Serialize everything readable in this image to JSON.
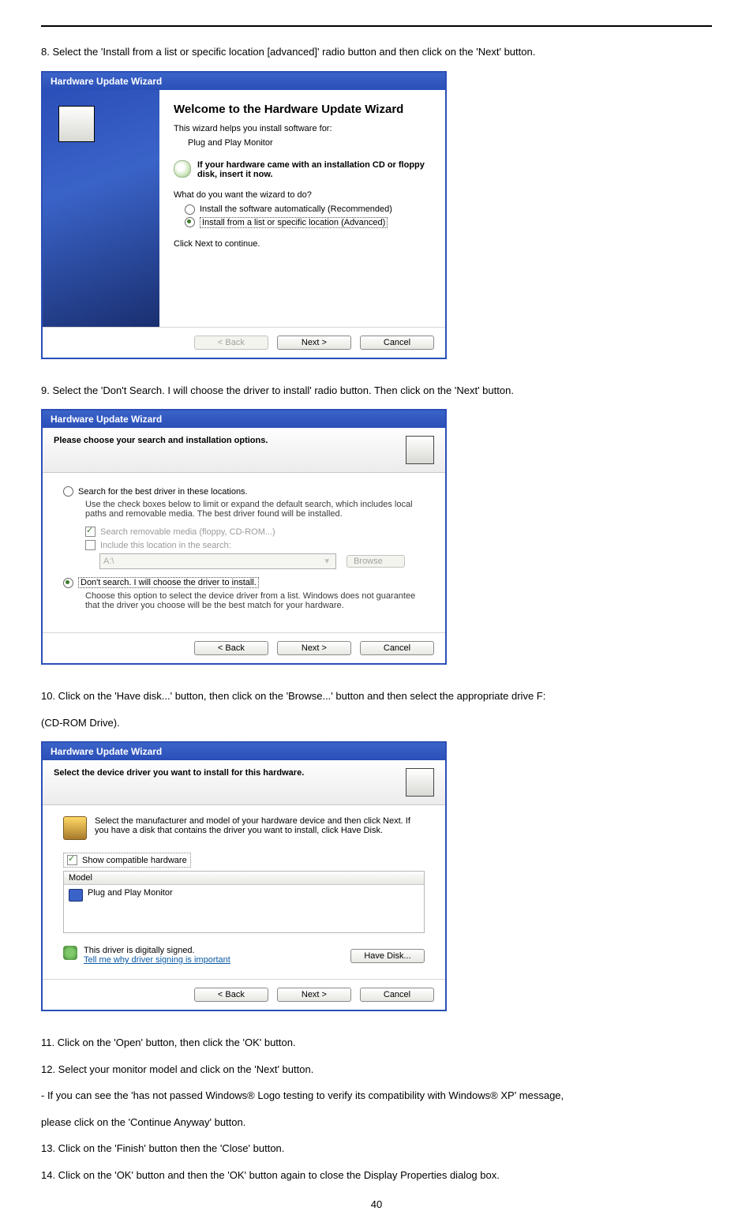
{
  "steps": {
    "s8": "8. Select the 'Install from a list or specific location [advanced]' radio button and then click on the 'Next' button.",
    "s9": "9. Select the 'Don't Search. I will choose the driver to install' radio button. Then click on the 'Next' button.",
    "s10a": "10. Click on the 'Have disk...' button, then click on the 'Browse...' button and then select the appropriate drive F:",
    "s10b": "(CD-ROM Drive).",
    "s11": "11. Click on the 'Open' button, then click the 'OK' button.",
    "s12": "12. Select your monitor model and click on the 'Next' button.",
    "s_note": "- If you can see the 'has not passed Windows® Logo testing to verify its compatibility with Windows® XP' message,",
    "s_note2": "please click on the 'Continue Anyway' button.",
    "s13": "13. Click on the 'Finish' button then the 'Close' button.",
    "s14": "14. Click on the 'OK' button and then the 'OK' button again to close the Display Properties dialog box."
  },
  "dlg_title": "Hardware Update Wizard",
  "buttons": {
    "back": "< Back",
    "next": "Next >",
    "cancel": "Cancel",
    "browse": "Browse",
    "have_disk": "Have Disk..."
  },
  "dlg1": {
    "h": "Welcome to the Hardware Update Wizard",
    "line1": "This wizard helps you install software for:",
    "device": "Plug and Play Monitor",
    "note": "If your hardware came with an installation CD or floppy disk, insert it now.",
    "q": "What do you want the wizard to do?",
    "opt1": "Install the software automatically (Recommended)",
    "opt2": "Install from a list or specific location (Advanced)",
    "cont": "Click Next to continue."
  },
  "dlg2": {
    "hdr": "Please choose your search and installation options.",
    "opt1": "Search for the best driver in these locations.",
    "opt1_help": "Use the check boxes below to limit or expand the default search, which includes local paths and removable media. The best driver found will be installed.",
    "chk1": "Search removable media (floppy, CD-ROM...)",
    "chk2": "Include this location in the search:",
    "path": "A:\\",
    "opt2": "Don't search. I will choose the driver to install.",
    "opt2_help": "Choose this option to select the device driver from a list.  Windows does not guarantee that the driver you choose will be the best match for your hardware."
  },
  "dlg3": {
    "hdr": "Select the device driver you want to install for this hardware.",
    "instr": "Select the manufacturer and model of your hardware device and then click Next. If you have a disk that contains the driver you want to install, click Have Disk.",
    "show_compat": "Show compatible hardware",
    "col": "Model",
    "item": "Plug and Play Monitor",
    "signed": "This driver is digitally signed.",
    "tellme": "Tell me why driver signing is important"
  },
  "page_num": "40"
}
